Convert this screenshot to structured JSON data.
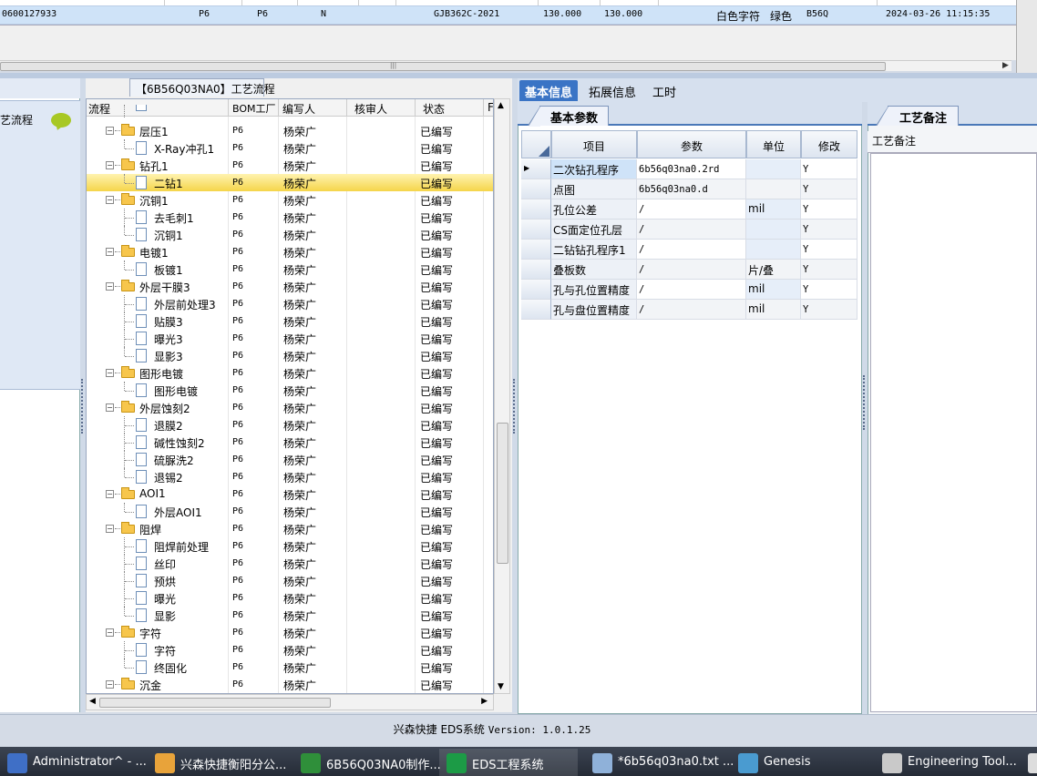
{
  "top_row": {
    "c1": "0600127933",
    "c2": "P6",
    "c3": "P6",
    "c4": "N",
    "c5": "GJB362C-2021",
    "c6": "130.000",
    "c7": "130.000",
    "c8": "白色字符",
    "c9": "绿色",
    "c10": "B56Q",
    "c11": "2024-03-26 11:15:35"
  },
  "left_panel": {
    "item_label": "艺流程"
  },
  "tree": {
    "tab_title": "【6B56Q03NA0】工艺流程",
    "headers": {
      "flow": "流程",
      "bom": "BOM工厂",
      "writer": "编写人",
      "reviewer": "核审人",
      "status": "状态",
      "extra": "F"
    },
    "rows": [
      {
        "name": "层压1",
        "bom": "P6",
        "writer": "杨荣广",
        "status": "已编写"
      },
      {
        "name": "X-Ray冲孔1",
        "bom": "P6",
        "writer": "杨荣广",
        "status": "已编写"
      },
      {
        "name": "钻孔1",
        "bom": "P6",
        "writer": "杨荣广",
        "status": "已编写"
      },
      {
        "name": "二钻1",
        "bom": "P6",
        "writer": "杨荣广",
        "status": "已编写"
      },
      {
        "name": "沉铜1",
        "bom": "P6",
        "writer": "杨荣广",
        "status": "已编写"
      },
      {
        "name": "去毛刺1",
        "bom": "P6",
        "writer": "杨荣广",
        "status": "已编写"
      },
      {
        "name": "沉铜1",
        "bom": "P6",
        "writer": "杨荣广",
        "status": "已编写"
      },
      {
        "name": "电镀1",
        "bom": "P6",
        "writer": "杨荣广",
        "status": "已编写"
      },
      {
        "name": "板镀1",
        "bom": "P6",
        "writer": "杨荣广",
        "status": "已编写"
      },
      {
        "name": "外层干膜3",
        "bom": "P6",
        "writer": "杨荣广",
        "status": "已编写"
      },
      {
        "name": "外层前处理3",
        "bom": "P6",
        "writer": "杨荣广",
        "status": "已编写"
      },
      {
        "name": "贴膜3",
        "bom": "P6",
        "writer": "杨荣广",
        "status": "已编写"
      },
      {
        "name": "曝光3",
        "bom": "P6",
        "writer": "杨荣广",
        "status": "已编写"
      },
      {
        "name": "显影3",
        "bom": "P6",
        "writer": "杨荣广",
        "status": "已编写"
      },
      {
        "name": "图形电镀",
        "bom": "P6",
        "writer": "杨荣广",
        "status": "已编写"
      },
      {
        "name": "图形电镀",
        "bom": "P6",
        "writer": "杨荣广",
        "status": "已编写"
      },
      {
        "name": "外层蚀刻2",
        "bom": "P6",
        "writer": "杨荣广",
        "status": "已编写"
      },
      {
        "name": "退膜2",
        "bom": "P6",
        "writer": "杨荣广",
        "status": "已编写"
      },
      {
        "name": "碱性蚀刻2",
        "bom": "P6",
        "writer": "杨荣广",
        "status": "已编写"
      },
      {
        "name": "硫脲洗2",
        "bom": "P6",
        "writer": "杨荣广",
        "status": "已编写"
      },
      {
        "name": "退锡2",
        "bom": "P6",
        "writer": "杨荣广",
        "status": "已编写"
      },
      {
        "name": "AOI1",
        "bom": "P6",
        "writer": "杨荣广",
        "status": "已编写"
      },
      {
        "name": "外层AOI1",
        "bom": "P6",
        "writer": "杨荣广",
        "status": "已编写"
      },
      {
        "name": "阻焊",
        "bom": "P6",
        "writer": "杨荣广",
        "status": "已编写"
      },
      {
        "name": "阻焊前处理",
        "bom": "P6",
        "writer": "杨荣广",
        "status": "已编写"
      },
      {
        "name": "丝印",
        "bom": "P6",
        "writer": "杨荣广",
        "status": "已编写"
      },
      {
        "name": "预烘",
        "bom": "P6",
        "writer": "杨荣广",
        "status": "已编写"
      },
      {
        "name": "曝光",
        "bom": "P6",
        "writer": "杨荣广",
        "status": "已编写"
      },
      {
        "name": "显影",
        "bom": "P6",
        "writer": "杨荣广",
        "status": "已编写"
      },
      {
        "name": "字符",
        "bom": "P6",
        "writer": "杨荣广",
        "status": "已编写"
      },
      {
        "name": "字符",
        "bom": "P6",
        "writer": "杨荣广",
        "status": "已编写"
      },
      {
        "name": "终固化",
        "bom": "P6",
        "writer": "杨荣广",
        "status": "已编写"
      },
      {
        "name": "沉金",
        "bom": "P6",
        "writer": "杨荣广",
        "status": "已编写"
      }
    ]
  },
  "right_tabs": {
    "basic": "基本信息",
    "extended": "拓展信息",
    "hours": "工时"
  },
  "basic_params": {
    "tab": "基本参数",
    "headers": {
      "item": "项目",
      "param": "参数",
      "unit": "单位",
      "modify": "修改"
    },
    "rows": [
      {
        "item": "二次钻孔程序",
        "param": "6b56q03na0.2rd",
        "unit": "",
        "modify": "Y"
      },
      {
        "item": "点图",
        "param": "6b56q03na0.d",
        "unit": "",
        "modify": "Y"
      },
      {
        "item": "孔位公差",
        "param": "/",
        "unit": "mil",
        "modify": "Y"
      },
      {
        "item": "CS面定位孔层",
        "param": "/",
        "unit": "",
        "modify": "Y"
      },
      {
        "item": "二钻钻孔程序1",
        "param": "/",
        "unit": "",
        "modify": "Y"
      },
      {
        "item": "叠板数",
        "param": "/",
        "unit": "片/叠",
        "modify": "Y"
      },
      {
        "item": "孔与孔位置精度",
        "param": "/",
        "unit": "mil",
        "modify": "Y"
      },
      {
        "item": "孔与盘位置精度",
        "param": "/",
        "unit": "mil",
        "modify": "Y"
      }
    ]
  },
  "remarks": {
    "tab": "工艺备注",
    "label": "工艺备注"
  },
  "status_bar": {
    "text": "兴森快捷 EDS系统 ",
    "version": "Version: 1.0.1.25"
  },
  "taskbar": [
    {
      "label": "Administrator^ - ...",
      "color": "#3f6fc6"
    },
    {
      "label": "兴森快捷衡阳分公...",
      "color": "#e8a33a"
    },
    {
      "label": "6B56Q03NA0制作...",
      "color": "#2f8f3a"
    },
    {
      "label": "EDS工程系统",
      "color": "#1c9b46"
    },
    {
      "label": "*6b56q03na0.txt ...",
      "color": "#8fb1d9"
    },
    {
      "label": "Genesis",
      "color": "#4a9bd0"
    },
    {
      "label": "Engineering Tool...",
      "color": "#c9c9c9"
    }
  ]
}
